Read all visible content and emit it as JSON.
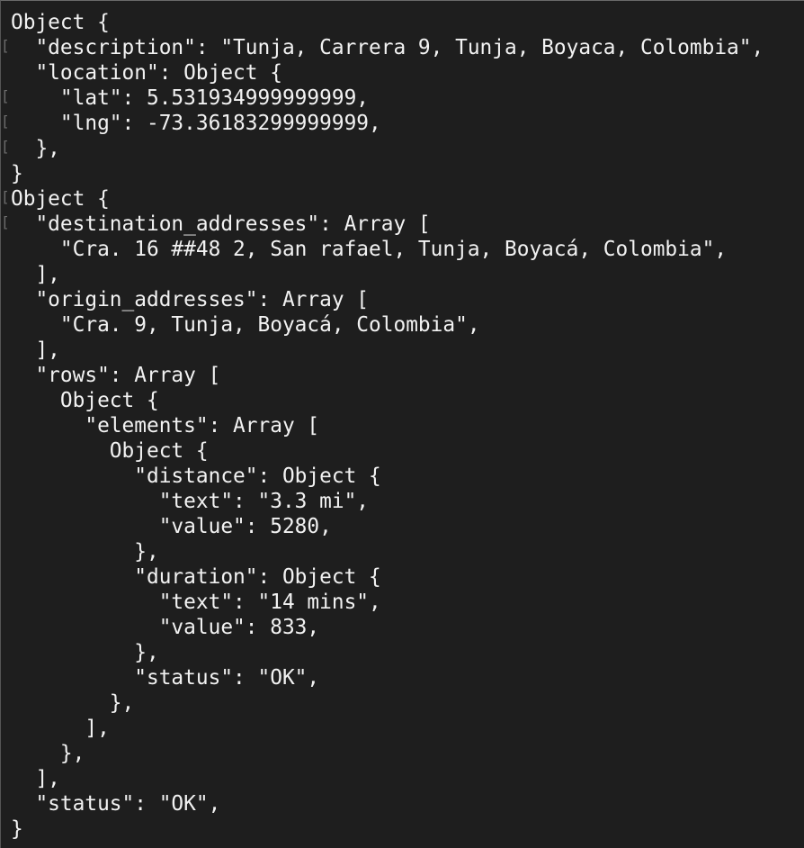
{
  "console": {
    "gutter_glyph": "[",
    "lines": [
      {
        "text": "Object {",
        "gutter": false
      },
      {
        "text": "  \"description\": \"Tunja, Carrera 9, Tunja, Boyaca, Colombia\",",
        "gutter": true
      },
      {
        "text": "  \"location\": Object {",
        "gutter": false
      },
      {
        "text": "    \"lat\": 5.531934999999999,",
        "gutter": true
      },
      {
        "text": "    \"lng\": -73.36183299999999,",
        "gutter": true
      },
      {
        "text": "  },",
        "gutter": true
      },
      {
        "text": "}",
        "gutter": false
      },
      {
        "text": "Object {",
        "gutter": true
      },
      {
        "text": "  \"destination_addresses\": Array [",
        "gutter": true
      },
      {
        "text": "    \"Cra. 16 ##48 2, San rafael, Tunja, Boyacá, Colombia\",",
        "gutter": false
      },
      {
        "text": "  ],",
        "gutter": false
      },
      {
        "text": "  \"origin_addresses\": Array [",
        "gutter": false
      },
      {
        "text": "    \"Cra. 9, Tunja, Boyacá, Colombia\",",
        "gutter": false
      },
      {
        "text": "  ],",
        "gutter": false
      },
      {
        "text": "  \"rows\": Array [",
        "gutter": false
      },
      {
        "text": "    Object {",
        "gutter": false
      },
      {
        "text": "      \"elements\": Array [",
        "gutter": false
      },
      {
        "text": "        Object {",
        "gutter": false
      },
      {
        "text": "          \"distance\": Object {",
        "gutter": false
      },
      {
        "text": "            \"text\": \"3.3 mi\",",
        "gutter": false
      },
      {
        "text": "            \"value\": 5280,",
        "gutter": false
      },
      {
        "text": "          },",
        "gutter": false
      },
      {
        "text": "          \"duration\": Object {",
        "gutter": false
      },
      {
        "text": "            \"text\": \"14 mins\",",
        "gutter": false
      },
      {
        "text": "            \"value\": 833,",
        "gutter": false
      },
      {
        "text": "          },",
        "gutter": false
      },
      {
        "text": "          \"status\": \"OK\",",
        "gutter": false
      },
      {
        "text": "        },",
        "gutter": false
      },
      {
        "text": "      ],",
        "gutter": false
      },
      {
        "text": "    },",
        "gutter": false
      },
      {
        "text": "  ],",
        "gutter": false
      },
      {
        "text": "  \"status\": \"OK\",",
        "gutter": false
      },
      {
        "text": "}",
        "gutter": false
      }
    ]
  }
}
